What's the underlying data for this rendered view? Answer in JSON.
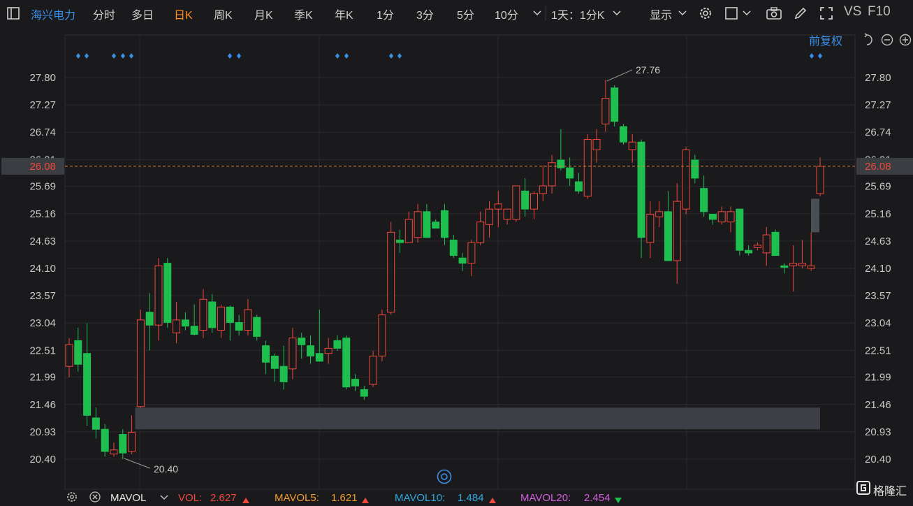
{
  "toolbar": {
    "stock_name": "海兴电力",
    "periods": [
      {
        "label": "分时",
        "active": false
      },
      {
        "label": "多日",
        "active": false
      },
      {
        "label": "日K",
        "active": true
      },
      {
        "label": "周K",
        "active": false
      },
      {
        "label": "月K",
        "active": false
      },
      {
        "label": "季K",
        "active": false
      },
      {
        "label": "年K",
        "active": false
      },
      {
        "label": "1分",
        "active": false
      },
      {
        "label": "3分",
        "active": false
      },
      {
        "label": "5分",
        "active": false
      },
      {
        "label": "10分",
        "active": false
      }
    ],
    "interval_select": "1天：1分K",
    "display_label": "显示",
    "vs_label": "VS",
    "f10_label": "F10"
  },
  "chart": {
    "adjust_label": "前复权",
    "current_price": "26.08",
    "high_label": "27.76",
    "low_label": "20.40",
    "y_ticks": [
      "27.80",
      "27.27",
      "26.74",
      "26.21",
      "25.69",
      "25.16",
      "24.63",
      "24.10",
      "23.57",
      "23.04",
      "22.51",
      "21.99",
      "21.46",
      "20.93",
      "20.40"
    ],
    "colors": {
      "up": "#f0483c",
      "down": "#1fbf4f",
      "grid": "#2a2a2e",
      "price_line": "#e0803a",
      "marker": "#3a8fe8",
      "gap_band": "#3c4046"
    }
  },
  "chart_data": {
    "type": "candlestick",
    "ylim": [
      20.25,
      28.1
    ],
    "candles": [
      {
        "o": 22.2,
        "h": 22.75,
        "l": 21.99,
        "c": 22.62
      },
      {
        "o": 22.7,
        "h": 22.95,
        "l": 22.1,
        "c": 22.24
      },
      {
        "o": 22.45,
        "h": 23.04,
        "l": 21.05,
        "c": 21.25
      },
      {
        "o": 21.2,
        "h": 21.4,
        "l": 20.8,
        "c": 20.98
      },
      {
        "o": 20.98,
        "h": 21.08,
        "l": 20.45,
        "c": 20.55
      },
      {
        "o": 20.5,
        "h": 20.72,
        "l": 20.45,
        "c": 20.58
      },
      {
        "o": 20.88,
        "h": 20.98,
        "l": 20.4,
        "c": 20.52
      },
      {
        "o": 20.55,
        "h": 21.25,
        "l": 20.5,
        "c": 20.92
      },
      {
        "o": 21.42,
        "h": 23.3,
        "l": 21.4,
        "c": 23.1
      },
      {
        "o": 23.25,
        "h": 23.62,
        "l": 22.51,
        "c": 23.0
      },
      {
        "o": 23.0,
        "h": 24.3,
        "l": 22.7,
        "c": 24.15
      },
      {
        "o": 24.2,
        "h": 24.3,
        "l": 22.95,
        "c": 23.05
      },
      {
        "o": 22.85,
        "h": 23.45,
        "l": 22.65,
        "c": 23.1
      },
      {
        "o": 23.1,
        "h": 23.25,
        "l": 22.9,
        "c": 22.98
      },
      {
        "o": 22.98,
        "h": 23.4,
        "l": 22.8,
        "c": 22.82
      },
      {
        "o": 22.9,
        "h": 23.7,
        "l": 22.75,
        "c": 23.5
      },
      {
        "o": 23.45,
        "h": 23.6,
        "l": 22.85,
        "c": 22.95
      },
      {
        "o": 22.9,
        "h": 23.4,
        "l": 22.75,
        "c": 23.35
      },
      {
        "o": 23.35,
        "h": 23.38,
        "l": 22.7,
        "c": 23.05
      },
      {
        "o": 23.05,
        "h": 23.2,
        "l": 22.8,
        "c": 22.9
      },
      {
        "o": 22.9,
        "h": 23.5,
        "l": 22.8,
        "c": 23.3
      },
      {
        "o": 23.15,
        "h": 23.2,
        "l": 22.7,
        "c": 22.78
      },
      {
        "o": 22.6,
        "h": 22.7,
        "l": 22.05,
        "c": 22.28
      },
      {
        "o": 22.4,
        "h": 22.45,
        "l": 21.9,
        "c": 22.16
      },
      {
        "o": 22.2,
        "h": 22.6,
        "l": 21.75,
        "c": 21.9
      },
      {
        "o": 22.15,
        "h": 22.95,
        "l": 21.95,
        "c": 22.75
      },
      {
        "o": 22.75,
        "h": 22.85,
        "l": 22.35,
        "c": 22.62
      },
      {
        "o": 22.6,
        "h": 22.8,
        "l": 22.25,
        "c": 22.4
      },
      {
        "o": 22.45,
        "h": 23.3,
        "l": 22.3,
        "c": 22.3
      },
      {
        "o": 22.45,
        "h": 22.75,
        "l": 22.25,
        "c": 22.55
      },
      {
        "o": 22.7,
        "h": 22.8,
        "l": 22.5,
        "c": 22.55
      },
      {
        "o": 22.75,
        "h": 22.8,
        "l": 21.75,
        "c": 21.8
      },
      {
        "o": 21.95,
        "h": 22.05,
        "l": 21.72,
        "c": 21.82
      },
      {
        "o": 21.75,
        "h": 21.82,
        "l": 21.55,
        "c": 21.62
      },
      {
        "o": 21.85,
        "h": 22.5,
        "l": 21.8,
        "c": 22.4
      },
      {
        "o": 22.4,
        "h": 23.3,
        "l": 22.3,
        "c": 23.2
      },
      {
        "o": 23.25,
        "h": 25.0,
        "l": 23.2,
        "c": 24.8
      },
      {
        "o": 24.65,
        "h": 24.85,
        "l": 24.4,
        "c": 24.6
      },
      {
        "o": 24.6,
        "h": 25.2,
        "l": 24.6,
        "c": 25.05
      },
      {
        "o": 24.7,
        "h": 25.35,
        "l": 24.6,
        "c": 25.2
      },
      {
        "o": 25.2,
        "h": 25.35,
        "l": 24.7,
        "c": 24.7
      },
      {
        "o": 25.0,
        "h": 25.05,
        "l": 24.9,
        "c": 24.88
      },
      {
        "o": 25.22,
        "h": 25.35,
        "l": 24.55,
        "c": 24.7
      },
      {
        "o": 24.65,
        "h": 24.75,
        "l": 24.3,
        "c": 24.35
      },
      {
        "o": 24.3,
        "h": 24.4,
        "l": 24.05,
        "c": 24.2
      },
      {
        "o": 24.2,
        "h": 24.65,
        "l": 23.95,
        "c": 24.6
      },
      {
        "o": 24.6,
        "h": 25.2,
        "l": 24.55,
        "c": 25.0
      },
      {
        "o": 24.95,
        "h": 25.4,
        "l": 24.7,
        "c": 25.25
      },
      {
        "o": 25.25,
        "h": 25.6,
        "l": 24.9,
        "c": 25.35
      },
      {
        "o": 25.05,
        "h": 25.1,
        "l": 24.95,
        "c": 25.25
      },
      {
        "o": 25.05,
        "h": 25.7,
        "l": 25.0,
        "c": 25.7
      },
      {
        "o": 25.6,
        "h": 25.85,
        "l": 25.1,
        "c": 25.25
      },
      {
        "o": 25.25,
        "h": 25.6,
        "l": 25.05,
        "c": 25.55
      },
      {
        "o": 25.55,
        "h": 26.1,
        "l": 25.4,
        "c": 25.7
      },
      {
        "o": 25.7,
        "h": 26.3,
        "l": 25.55,
        "c": 26.15
      },
      {
        "o": 26.2,
        "h": 26.8,
        "l": 26.0,
        "c": 26.05
      },
      {
        "o": 26.05,
        "h": 26.25,
        "l": 25.7,
        "c": 25.85
      },
      {
        "o": 25.78,
        "h": 25.95,
        "l": 25.55,
        "c": 25.6
      },
      {
        "o": 25.5,
        "h": 26.7,
        "l": 25.45,
        "c": 26.6
      },
      {
        "o": 26.4,
        "h": 26.8,
        "l": 26.15,
        "c": 26.6
      },
      {
        "o": 26.9,
        "h": 27.76,
        "l": 26.75,
        "c": 27.4
      },
      {
        "o": 27.6,
        "h": 27.65,
        "l": 26.85,
        "c": 26.95
      },
      {
        "o": 26.85,
        "h": 26.9,
        "l": 26.5,
        "c": 26.55
      },
      {
        "o": 26.4,
        "h": 26.7,
        "l": 26.15,
        "c": 26.55
      },
      {
        "o": 26.55,
        "h": 26.6,
        "l": 24.3,
        "c": 24.7
      },
      {
        "o": 24.6,
        "h": 25.4,
        "l": 24.3,
        "c": 25.15
      },
      {
        "o": 25.1,
        "h": 25.4,
        "l": 24.9,
        "c": 25.2
      },
      {
        "o": 25.2,
        "h": 25.6,
        "l": 24.25,
        "c": 24.25
      },
      {
        "o": 24.25,
        "h": 25.75,
        "l": 23.8,
        "c": 25.4
      },
      {
        "o": 25.25,
        "h": 26.45,
        "l": 25.15,
        "c": 26.4
      },
      {
        "o": 26.2,
        "h": 26.3,
        "l": 25.75,
        "c": 25.85
      },
      {
        "o": 25.65,
        "h": 25.9,
        "l": 25.1,
        "c": 25.2
      },
      {
        "o": 25.15,
        "h": 25.15,
        "l": 24.95,
        "c": 25.05
      },
      {
        "o": 25.0,
        "h": 25.3,
        "l": 24.95,
        "c": 25.2
      },
      {
        "o": 25.0,
        "h": 25.3,
        "l": 24.8,
        "c": 25.2
      },
      {
        "o": 25.25,
        "h": 25.25,
        "l": 24.35,
        "c": 24.45
      },
      {
        "o": 24.45,
        "h": 24.55,
        "l": 24.35,
        "c": 24.4
      },
      {
        "o": 24.5,
        "h": 24.6,
        "l": 24.45,
        "c": 24.55
      },
      {
        "o": 24.4,
        "h": 24.9,
        "l": 24.15,
        "c": 24.75
      },
      {
        "o": 24.8,
        "h": 24.85,
        "l": 24.35,
        "c": 24.35
      },
      {
        "o": 24.15,
        "h": 24.2,
        "l": 24.0,
        "c": 24.12
      },
      {
        "o": 24.15,
        "h": 24.55,
        "l": 23.65,
        "c": 24.2
      },
      {
        "o": 24.15,
        "h": 24.65,
        "l": 24.1,
        "c": 24.2
      },
      {
        "o": 24.1,
        "h": 24.8,
        "l": 24.05,
        "c": 24.15
      },
      {
        "o": 25.55,
        "h": 26.25,
        "l": 25.5,
        "c": 26.08
      }
    ],
    "gaps": [
      {
        "from": 20.98,
        "to": 21.4
      },
      {
        "from": 24.8,
        "to": 25.45
      }
    ]
  },
  "indicator_bar": {
    "mavol_label": "MAVOL",
    "vol_label": "VOL:",
    "vol_value": "2.627",
    "mavol5_label": "MAVOL5:",
    "mavol5_value": "1.621",
    "mavol10_label": "MAVOL10:",
    "mavol10_value": "1.484",
    "mavol20_label": "MAVOL20:",
    "mavol20_value": "2.454"
  },
  "watermark": "格隆汇"
}
